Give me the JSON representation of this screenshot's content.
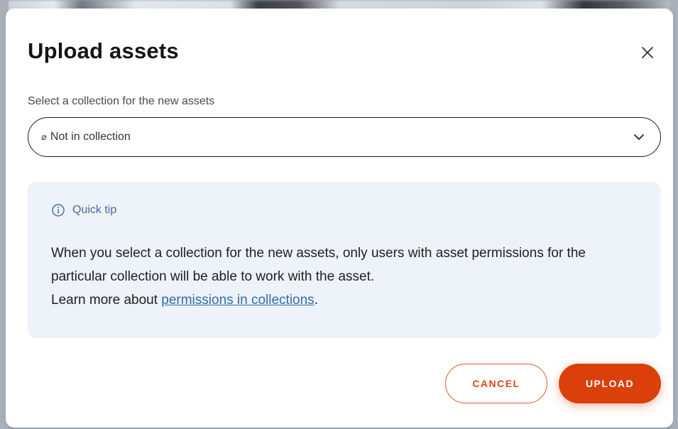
{
  "modal": {
    "title": "Upload assets"
  },
  "collection_select": {
    "label": "Select a collection for the new assets",
    "icon": "⌀",
    "value": "Not in collection"
  },
  "tip": {
    "title": "Quick tip",
    "text": "When you select a collection for the new assets, only users with asset permissions for the particular collection will be able to work with the asset.",
    "more_prefix": "Learn more about ",
    "link_text": "permissions in collections",
    "more_suffix": "."
  },
  "actions": {
    "cancel_label": "CANCEL",
    "upload_label": "UPLOAD"
  },
  "colors": {
    "primary": "#db3f0a",
    "tip_background": "#eef2f9",
    "link": "#2d6fa8"
  }
}
